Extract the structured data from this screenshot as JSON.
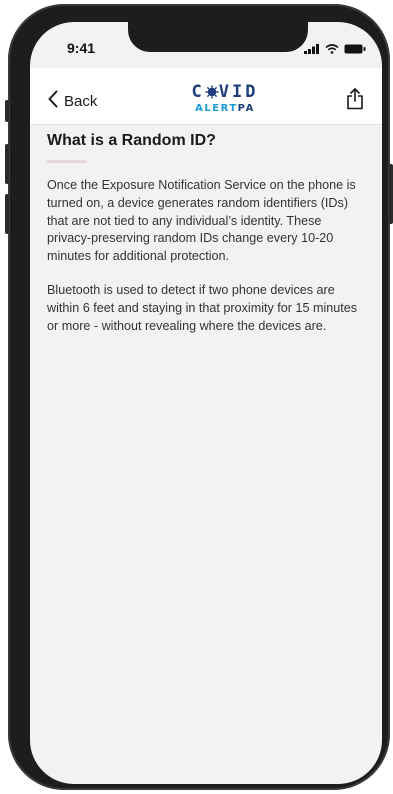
{
  "status_bar": {
    "time": "9:41"
  },
  "nav": {
    "back_label": "Back",
    "logo_top": "C VID",
    "logo_bottom_alert": "ALERT",
    "logo_bottom_pa": "PA"
  },
  "article": {
    "title": "What is a Random ID?",
    "paragraphs": [
      "Once the Exposure Notification Service on the phone is turned on, a device generates random identifiers (IDs) that are not tied to any individual’s identity. These privacy-preserving random IDs change every 10-20 minutes for additional protection.",
      "Bluetooth is used to detect if two phone devices are within 6 feet and staying in that proximity for 15 minutes or more - without revealing where the devices are."
    ]
  },
  "colors": {
    "brand_navy": "#1f3d7a",
    "brand_blue": "#1b9ad6",
    "screen_bg": "#f2f2f2",
    "accent_underline": "#e8d7d9"
  }
}
